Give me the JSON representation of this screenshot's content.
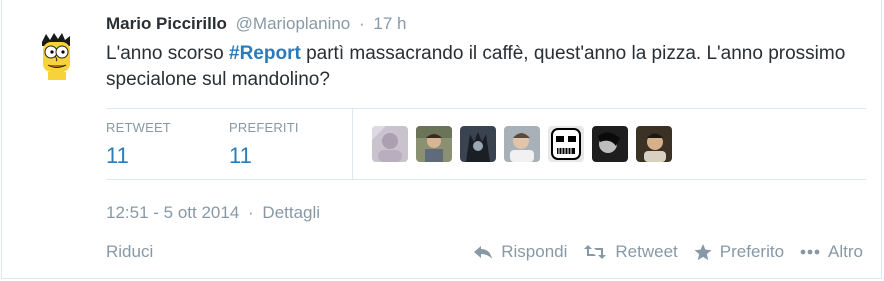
{
  "tweet": {
    "author_name": "Mario Piccirillo",
    "author_handle": "@Marioplanino",
    "separator": "·",
    "relative_time": "17 h",
    "text_before": "L'anno scorso ",
    "hashtag_symbol": "#",
    "hashtag_word": "Report",
    "text_after": " partì massacrando il caffè, quest'anno la pizza. L'anno prossimo specialone sul mandolino?"
  },
  "stats": {
    "retweets_label": "RETWEET",
    "retweets_count": "11",
    "favorites_label": "PREFERITI",
    "favorites_count": "11"
  },
  "favoriters": [
    {
      "name": "avatar-1",
      "bg": "#c8c3cc"
    },
    {
      "name": "avatar-2",
      "bg": "#8a9070"
    },
    {
      "name": "avatar-3",
      "bg": "#3a4350"
    },
    {
      "name": "avatar-4",
      "bg": "#a8b0b8"
    },
    {
      "name": "avatar-5",
      "bg": "#e8e8e8"
    },
    {
      "name": "avatar-6",
      "bg": "#1e1e1e"
    },
    {
      "name": "avatar-7",
      "bg": "#3b3225"
    }
  ],
  "meta": {
    "timestamp": "12:51 - 5 ott 2014",
    "separator": "·",
    "details_link": "Dettagli"
  },
  "actions": {
    "collapse": "Riduci",
    "reply": "Rispondi",
    "retweet": "Retweet",
    "favorite": "Preferito",
    "more": "Altro"
  },
  "colors": {
    "link": "#2b7bb9",
    "muted": "#8899a6",
    "text": "#292f33",
    "divider": "#e1e8ed"
  }
}
